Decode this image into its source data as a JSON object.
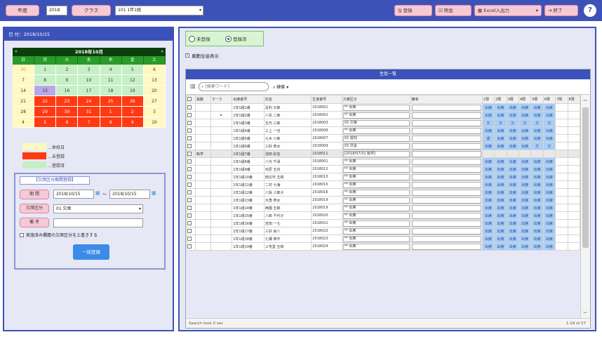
{
  "colors": {
    "primary": "#3d52b8",
    "pink": "#f6c9d6",
    "blue_button": "#3b8be8",
    "weekday_past": "#fff8c0",
    "unregistered": "#ff3a12",
    "registered": "#c6efc6",
    "status_ok": "#a9cef5"
  },
  "topbar": {
    "year_label": "年度",
    "year_value": "2018",
    "class_label": "クラス",
    "class_value": "101 1年1組",
    "actions": {
      "register": "登録",
      "report": "照会",
      "excel": "Excel入出力",
      "exit": "終了"
    },
    "help": "?"
  },
  "left": {
    "date_header": "日 付：2018/10/15",
    "calendar": {
      "title": "2018年10月",
      "prev": "«",
      "next": "»",
      "dows": [
        "日",
        "月",
        "火",
        "水",
        "木",
        "金",
        "土"
      ],
      "weeks": [
        [
          {
            "d": "30",
            "s": "gray"
          },
          {
            "d": "1",
            "s": "reg"
          },
          {
            "d": "2",
            "s": "reg"
          },
          {
            "d": "3",
            "s": "reg"
          },
          {
            "d": "4",
            "s": "reg"
          },
          {
            "d": "5",
            "s": "reg"
          },
          {
            "d": "6",
            "s": "hol"
          }
        ],
        [
          {
            "d": "7",
            "s": "hol"
          },
          {
            "d": "8",
            "s": "reg"
          },
          {
            "d": "9",
            "s": "reg"
          },
          {
            "d": "10",
            "s": "reg"
          },
          {
            "d": "11",
            "s": "reg"
          },
          {
            "d": "12",
            "s": "reg"
          },
          {
            "d": "13",
            "s": "hol"
          }
        ],
        [
          {
            "d": "14",
            "s": "hol"
          },
          {
            "d": "15",
            "s": "sel"
          },
          {
            "d": "16",
            "s": "reg"
          },
          {
            "d": "17",
            "s": "reg"
          },
          {
            "d": "18",
            "s": "reg"
          },
          {
            "d": "19",
            "s": "reg"
          },
          {
            "d": "20",
            "s": "hol"
          }
        ],
        [
          {
            "d": "21",
            "s": "hol"
          },
          {
            "d": "22",
            "s": "unreg"
          },
          {
            "d": "23",
            "s": "unreg"
          },
          {
            "d": "24",
            "s": "unreg"
          },
          {
            "d": "25",
            "s": "unreg"
          },
          {
            "d": "26",
            "s": "unreg"
          },
          {
            "d": "27",
            "s": "hol"
          }
        ],
        [
          {
            "d": "28",
            "s": "hol"
          },
          {
            "d": "29",
            "s": "unreg"
          },
          {
            "d": "30",
            "s": "unreg"
          },
          {
            "d": "31",
            "s": "unreg"
          },
          {
            "d": "1",
            "s": "unreg"
          },
          {
            "d": "2",
            "s": "unreg"
          },
          {
            "d": "3",
            "s": "hol"
          }
        ],
        [
          {
            "d": "4",
            "s": "hol"
          },
          {
            "d": "5",
            "s": "unreg"
          },
          {
            "d": "6",
            "s": "unreg"
          },
          {
            "d": "7",
            "s": "unreg"
          },
          {
            "d": "8",
            "s": "unreg"
          },
          {
            "d": "9",
            "s": "unreg"
          },
          {
            "d": "10",
            "s": "hol"
          }
        ]
      ]
    },
    "legend": [
      {
        "label": "…休校日",
        "color": "#fff8c0"
      },
      {
        "label": "…未登録",
        "color": "#ff3a12"
      },
      {
        "label": "…登録済",
        "color": "#c6efc6"
      }
    ],
    "bulk": {
      "title": "【欠席区分期間登録】",
      "period_label": "期 間",
      "date_from": "2018/10/15",
      "tilde": "～",
      "date_to": "2018/10/15",
      "absence_label": "欠席区分",
      "absence_value": "01 欠席",
      "remarks_label": "備 考",
      "remarks_value": "",
      "overwrite_label": "実施済み欄層の欠席区分を上書きする",
      "submit": "一括登録"
    }
  },
  "right": {
    "filter": {
      "opt_unregistered": "未登録",
      "opt_registered": "登録済",
      "show_moved": "異動生徒表示"
    },
    "grid": {
      "title": "生徒一覧",
      "search_placeholder": "[検索ワード]",
      "search_btn": "検索",
      "headers": [
        "異動",
        "マーク",
        "出席番号",
        "氏名",
        "生徒番号",
        "欠席区分",
        "備考",
        "1限",
        "2限",
        "3限",
        "4限",
        "5限",
        "6限",
        "7限",
        "8限"
      ],
      "rows": [
        {
          "move": "",
          "mark": "",
          "no": "1年1組1番",
          "name": "足利 大郎",
          "sid": "2018001",
          "abs": "** 出席",
          "note": "",
          "p": [
            "出席",
            "出席",
            "出席",
            "出席",
            "出席",
            "出席"
          ]
        },
        {
          "move": "",
          "mark": "▸",
          "no": "1年1組2番",
          "name": "八島 二郎",
          "sid": "2018002",
          "abs": "** 出席",
          "note": "",
          "p": [
            "出席",
            "出席",
            "出席",
            "出席",
            "出席",
            "出席"
          ]
        },
        {
          "move": "",
          "mark": "",
          "no": "1年1組3番",
          "name": "五代 三郎",
          "sid": "2018003",
          "abs": "03 欠席",
          "note": "",
          "p": [
            "欠",
            "欠",
            "欠",
            "欠",
            "欠",
            "欠"
          ]
        },
        {
          "move": "",
          "mark": "",
          "no": "1年1組4番",
          "name": "三上 一也",
          "sid": "2018006",
          "abs": "** 出席",
          "note": "",
          "p": [
            "出席",
            "出席",
            "出席",
            "出席",
            "出席",
            "出席"
          ]
        },
        {
          "move": "",
          "mark": "",
          "no": "1年1組5番",
          "name": "九木 六郎",
          "sid": "2018007",
          "abs": "02 遅刻",
          "note": "",
          "p": [
            "遅",
            "出席",
            "出席",
            "出席",
            "出席",
            "出席"
          ]
        },
        {
          "move": "",
          "mark": "",
          "no": "1年1組6番",
          "name": "三好 恭太",
          "sid": "2018009",
          "abs": "03 早退",
          "note": "",
          "p": [
            "出席",
            "出席",
            "出席",
            "出席",
            "欠",
            "欠"
          ]
        },
        {
          "move": "転学",
          "mark": "",
          "no": "1年1組7番",
          "name": "池田 彩名",
          "sid": "2018011",
          "abs": "[2018/07/31 転学]",
          "note": "",
          "p": [
            "",
            "",
            "",
            "",
            "",
            ""
          ]
        },
        {
          "move": "",
          "mark": "",
          "no": "1年1組8番",
          "name": "八代 千尋",
          "sid": "2018001",
          "abs": "** 出席",
          "note": "",
          "p": [
            "出席",
            "出席",
            "出席",
            "出席",
            "出席",
            "出席"
          ]
        },
        {
          "move": "",
          "mark": "",
          "no": "1年1組9番",
          "name": "石原 五内",
          "sid": "2018012",
          "abs": "** 出席",
          "note": "",
          "p": [
            "出席",
            "出席",
            "出席",
            "出席",
            "出席",
            "出席"
          ]
        },
        {
          "move": "",
          "mark": "",
          "no": "1年1組10番",
          "name": "田辺市 五和",
          "sid": "2018013",
          "abs": "** 出席",
          "note": "",
          "p": [
            "出席",
            "出席",
            "出席",
            "出席",
            "出席",
            "出席"
          ]
        },
        {
          "move": "",
          "mark": "",
          "no": "1年1組11番",
          "name": "二村 七海",
          "sid": "2018015",
          "abs": "** 出席",
          "note": "",
          "p": [
            "出席",
            "出席",
            "出席",
            "出席",
            "出席",
            "出席"
          ]
        },
        {
          "move": "",
          "mark": "",
          "no": "1年1組12番",
          "name": "八坂 三郎子",
          "sid": "2018016",
          "abs": "** 出席",
          "note": "",
          "p": [
            "出席",
            "出席",
            "出席",
            "出席",
            "出席",
            "出席"
          ]
        },
        {
          "move": "",
          "mark": "",
          "no": "1年1組13番",
          "name": "大角 恭太",
          "sid": "2018019",
          "abs": "** 出席",
          "note": "",
          "p": [
            "出席",
            "出席",
            "出席",
            "出席",
            "出席",
            "出席"
          ]
        },
        {
          "move": "",
          "mark": "",
          "no": "1年1組14番",
          "name": "西園 五郎",
          "sid": "2018019",
          "abs": "** 出席",
          "note": "",
          "p": [
            "出席",
            "出席",
            "出席",
            "出席",
            "出席",
            "出席"
          ]
        },
        {
          "move": "",
          "mark": "",
          "no": "1年1組15番",
          "name": "八郎 千代子",
          "sid": "2018020",
          "abs": "** 出席",
          "note": "",
          "p": [
            "出席",
            "出席",
            "出席",
            "出席",
            "出席",
            "出席"
          ]
        },
        {
          "move": "",
          "mark": "",
          "no": "1年1組16番",
          "name": "吉田 一七",
          "sid": "2018021",
          "abs": "** 出席",
          "note": "",
          "p": [
            "出席",
            "出席",
            "出席",
            "出席",
            "出席",
            "出席"
          ]
        },
        {
          "move": "",
          "mark": "",
          "no": "1年1組17番",
          "name": "三好 尚八",
          "sid": "2018022",
          "abs": "** 出席",
          "note": "",
          "p": [
            "出席",
            "出席",
            "出席",
            "出席",
            "出席",
            "出席"
          ]
        },
        {
          "move": "",
          "mark": "",
          "no": "1年1組18番",
          "name": "七瀬 英平",
          "sid": "2018023",
          "abs": "** 出席",
          "note": "",
          "p": [
            "出席",
            "出席",
            "出席",
            "出席",
            "出席",
            "出席"
          ]
        },
        {
          "move": "",
          "mark": "",
          "no": "1年1組19番",
          "name": "三宅堂 五和",
          "sid": "2018024",
          "abs": "** 出席",
          "note": "",
          "p": [
            "出席",
            "出席",
            "出席",
            "出席",
            "出席",
            "出席"
          ]
        }
      ],
      "footer_left": "Search took 0 sec",
      "footer_right": "1-19 of 27"
    }
  }
}
